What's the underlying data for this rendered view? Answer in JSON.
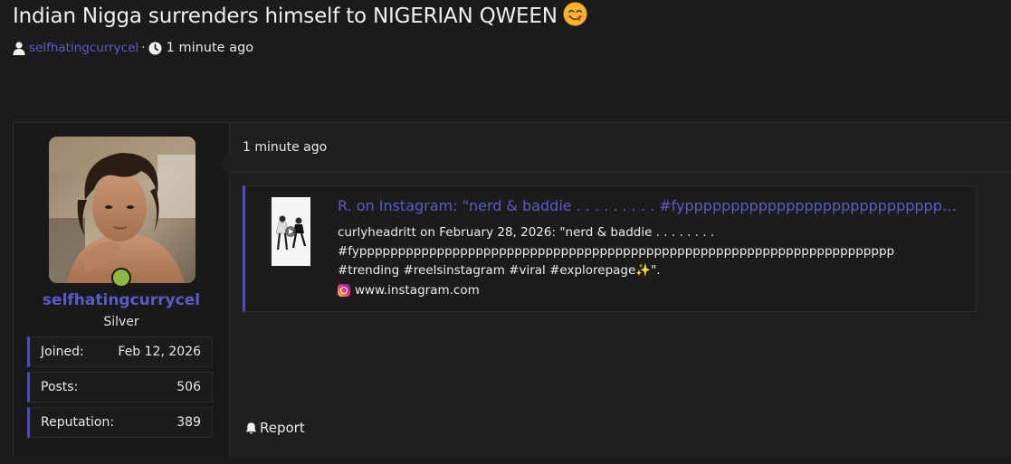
{
  "thread": {
    "title": "Indian Nigga surrenders himself to NIGERIAN QWEEN",
    "emoji_icon": "yum-face-icon",
    "author": "selfhatingcurrycel",
    "separator": "·",
    "time": "1 minute ago"
  },
  "user": {
    "name": "selfhatingcurrycel",
    "title": "Silver",
    "status_color": "#8bb83f",
    "stats": [
      {
        "label": "Joined:",
        "value": "Feb 12, 2026"
      },
      {
        "label": "Posts:",
        "value": "506"
      },
      {
        "label": "Reputation:",
        "value": "389"
      }
    ]
  },
  "post": {
    "time": "1 minute ago",
    "report_label": "Report",
    "embed": {
      "title": "R. on Instagram: \"nerd & baddie . . . . . . . . . #fypppppppppppppppppppppppppppppppppppppppp",
      "desc_lines": [
        "curlyheadritt on February 28, 2026: \"nerd & baddie . . . . . . . .",
        "#fyppppppppppppppppppppppppppppppppppppppppppppppppppppppppppppppppppppp",
        "#trending #reelsinstagram #viral #explorepage✨\"."
      ],
      "site": "www.instagram.com"
    }
  },
  "colors": {
    "accent": "#5b5bc8",
    "accent_border": "#4e4ec0",
    "background": "#1b1b1b"
  }
}
